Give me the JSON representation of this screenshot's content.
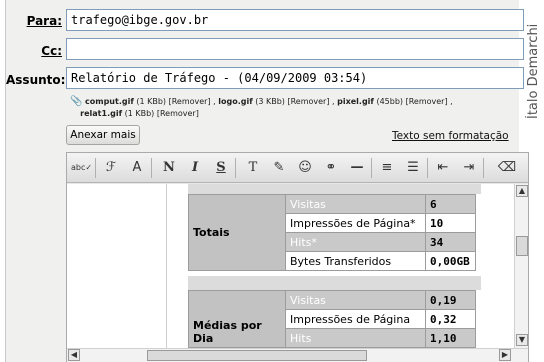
{
  "form": {
    "to_label": "Para:",
    "to_value": "trafego@ibge.gov.br",
    "cc_label": "Cc:",
    "cc_value": "",
    "subject_label": "Assunto:",
    "subject_value": "Relatório de Tráfego - (04/09/2009 03:54)"
  },
  "attachments": {
    "a1_name": "comput.gif",
    "a1_size": "(1 KBb)",
    "a2_name": "logo.gif",
    "a2_size": "(3 KBb)",
    "a3_name": "pixel.gif",
    "a3_size": "(45bb)",
    "a4_name": "relat1.gif",
    "a4_size": "(1 KBb)",
    "remove_label": "[Remover]",
    "separator": ","
  },
  "actions": {
    "attach_button": "Anexar mais",
    "plain_text_link": "Texto sem formatação"
  },
  "toolbar": {
    "spell": "abc✓",
    "font": "ℱ",
    "size": "A",
    "bold": "N",
    "italic": "I",
    "underline": "S",
    "text_color": "T",
    "highlight": "✎",
    "emoticon": "☺",
    "link": "⚭",
    "hr": "—",
    "ordered_list": "≡",
    "bullet_list": "☰",
    "outdent": "⇤",
    "indent": "⇥",
    "clear": "⌫"
  },
  "report": {
    "totais_label": "Totais",
    "totais": [
      {
        "k": "Visitas",
        "v": "6"
      },
      {
        "k": "Impressões de Página*",
        "v": "10"
      },
      {
        "k": "Hits*",
        "v": "34"
      },
      {
        "k": "Bytes Transferidos",
        "v": "0,00GB"
      }
    ],
    "medias_label": "Médias por Dia",
    "medias": [
      {
        "k": "Visitas",
        "v": "0,19"
      },
      {
        "k": "Impressões de Página",
        "v": "0,32"
      },
      {
        "k": "Hits",
        "v": "1,10"
      }
    ]
  },
  "credit": "Ítalo Demarchi"
}
